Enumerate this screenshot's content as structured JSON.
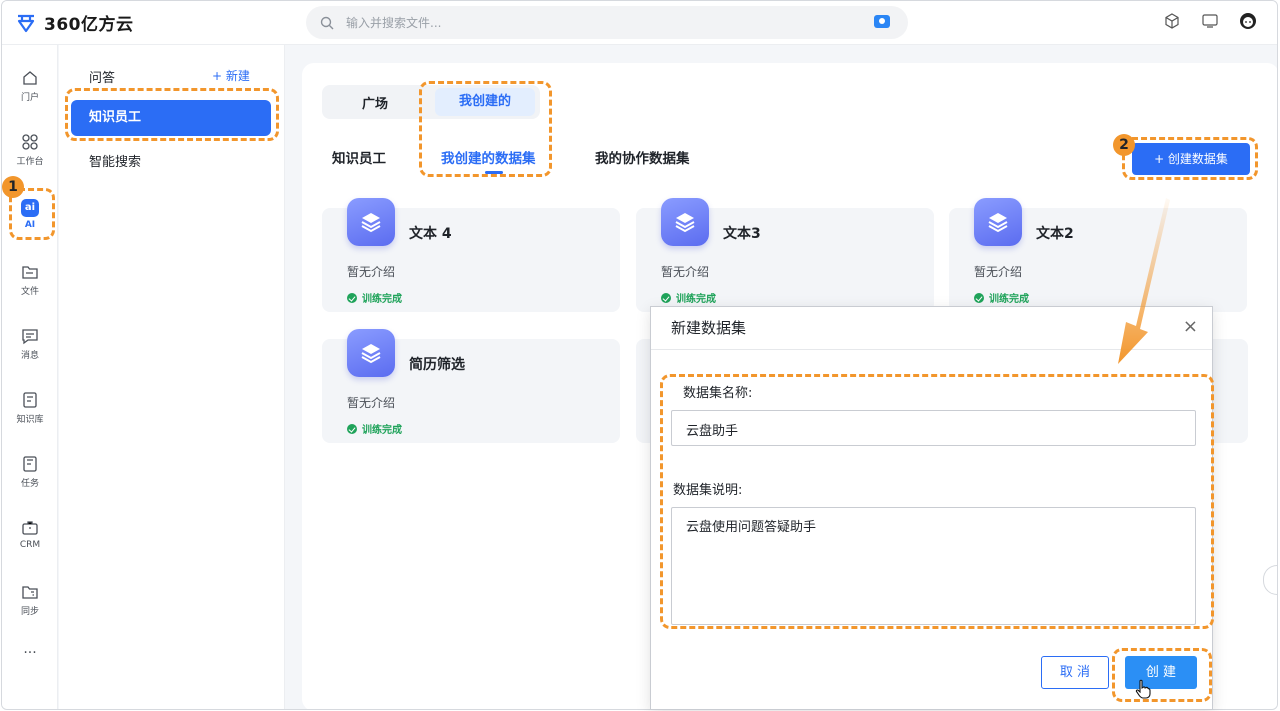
{
  "app": {
    "name": "360亿方云"
  },
  "search": {
    "placeholder": "输入并搜索文件..."
  },
  "rail": [
    {
      "label": "门户",
      "icon": "home-icon"
    },
    {
      "label": "工作台",
      "icon": "grid-icon"
    },
    {
      "label": "AI",
      "icon": "ai-icon",
      "active": true
    },
    {
      "label": "文件",
      "icon": "folder-icon"
    },
    {
      "label": "消息",
      "icon": "message-icon"
    },
    {
      "label": "知识库",
      "icon": "book-icon"
    },
    {
      "label": "任务",
      "icon": "task-icon"
    },
    {
      "label": "CRM",
      "icon": "briefcase-icon"
    },
    {
      "label": "同步",
      "icon": "sync-folder-icon"
    },
    {
      "label": "···",
      "icon": "more-icon"
    }
  ],
  "subnav": {
    "section": "问答",
    "new_label": "+ 新建",
    "items": [
      "知识员工",
      "智能搜索"
    ]
  },
  "segment": {
    "a": "广场",
    "b": "我创建的"
  },
  "subtabs": [
    "知识员工",
    "我创建的数据集",
    "我的协作数据集"
  ],
  "create_button": "+ 创建数据集",
  "cards": [
    {
      "title": "文本 4",
      "desc": "暂无介绍",
      "status": "训练完成"
    },
    {
      "title": "文本3",
      "desc": "暂无介绍",
      "status": "训练完成"
    },
    {
      "title": "文本2",
      "desc": "暂无介绍",
      "status": "训练完成"
    },
    {
      "title": "简历筛选",
      "desc": "暂无介绍",
      "status": "训练完成"
    }
  ],
  "dialog": {
    "title": "新建数据集",
    "name_label": "数据集名称:",
    "name_value": "云盘助手",
    "desc_label": "数据集说明:",
    "desc_value": "云盘使用问题答疑助手",
    "cancel": "取 消",
    "ok": "创 建"
  },
  "steps": [
    "1",
    "2"
  ],
  "colors": {
    "accent": "#2b6df5",
    "highlight": "#f2962c",
    "success": "#1fa35a"
  }
}
